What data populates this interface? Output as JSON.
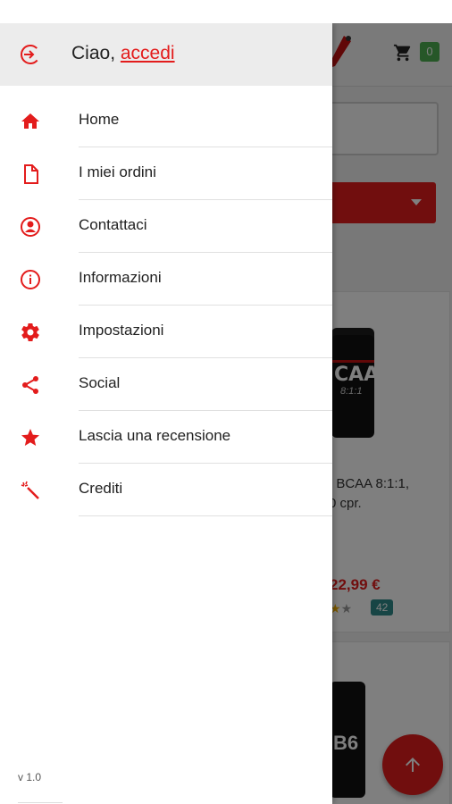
{
  "background": {
    "cart_count": "0",
    "product": {
      "jar_label": "CAA",
      "jar_sublabel": "8:1:1",
      "name": ", BCAA 8:1:1,\n0 cpr.",
      "price": "22,99 €",
      "rating_count": "42"
    },
    "product2": {
      "jar_label": "B6"
    }
  },
  "drawer": {
    "greeting": "Ciao,",
    "login_link": "accedi",
    "items": [
      {
        "label": "Home",
        "icon": "home-icon"
      },
      {
        "label": "I miei ordini",
        "icon": "document-icon"
      },
      {
        "label": "Contattaci",
        "icon": "contact-icon"
      },
      {
        "label": "Informazioni",
        "icon": "info-icon"
      },
      {
        "label": "Impostazioni",
        "icon": "gear-icon"
      },
      {
        "label": "Social",
        "icon": "share-icon"
      },
      {
        "label": "Lascia una recensione",
        "icon": "star-icon"
      },
      {
        "label": "Crediti",
        "icon": "magic-wand-icon"
      }
    ],
    "version": "v 1.0"
  },
  "colors": {
    "accent": "#e31c1c",
    "badge_green": "#4caf50",
    "count_teal": "#2e8b8b"
  }
}
